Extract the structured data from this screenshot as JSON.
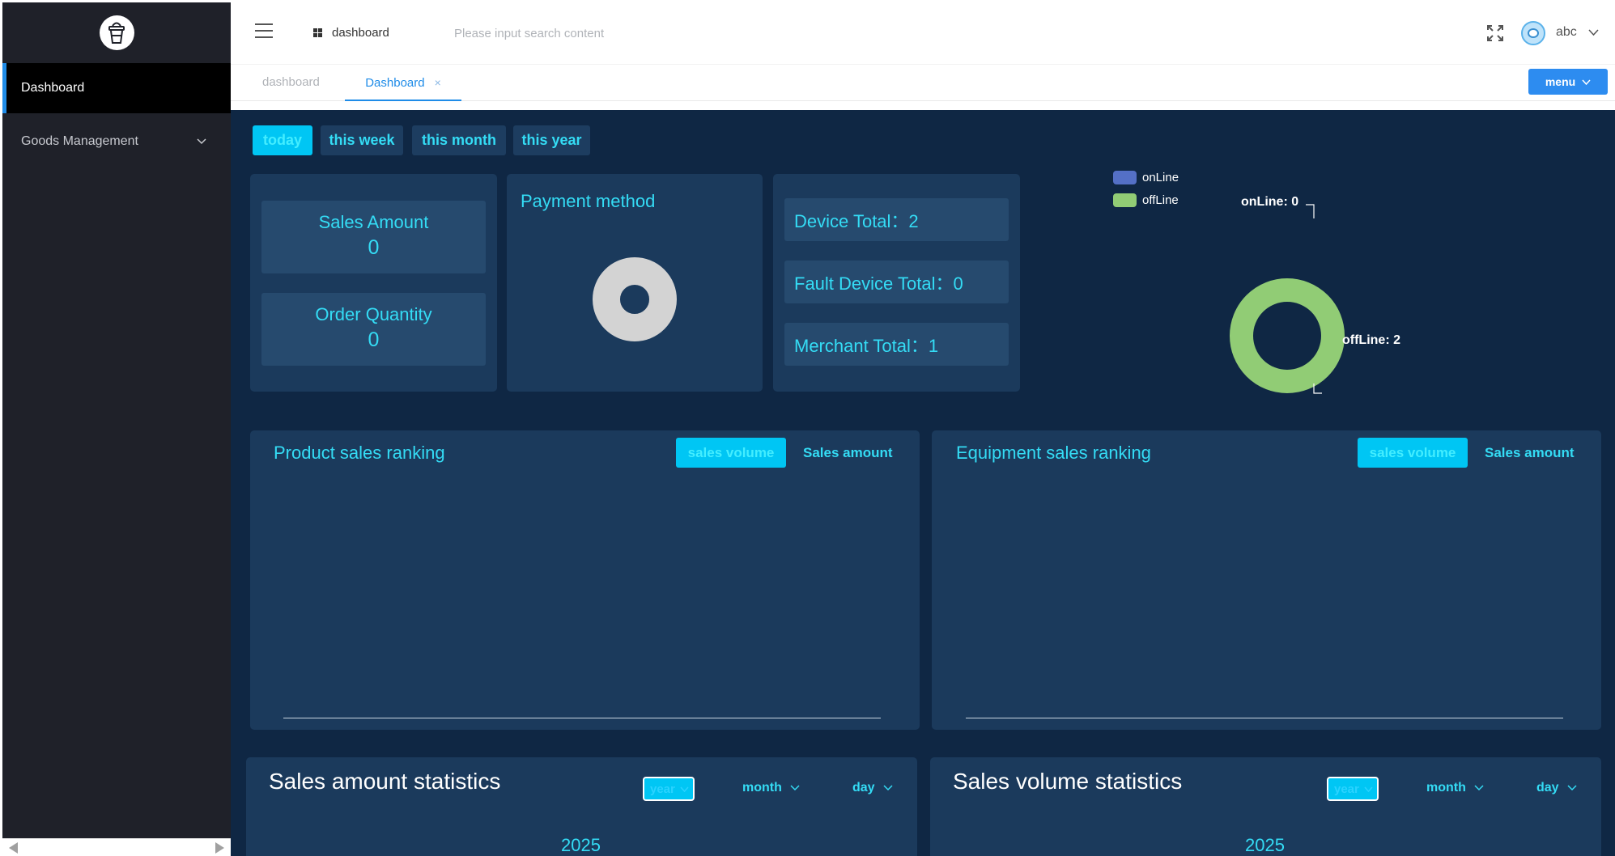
{
  "sidebar": {
    "logo_icon": "drink-cup-icon",
    "items": [
      {
        "label": "Dashboard",
        "active": true
      },
      {
        "label": "Goods Management",
        "active": false
      }
    ]
  },
  "header": {
    "breadcrumb": "dashboard",
    "search_placeholder": "Please input search content",
    "user_name": "abc"
  },
  "tabs": {
    "items": [
      "dashboard",
      "Dashboard"
    ],
    "close_symbol": "×",
    "menu_label": "menu"
  },
  "periods": [
    "today",
    "this week",
    "this month",
    "this year"
  ],
  "stats": {
    "sales_amount_label": "Sales Amount",
    "sales_amount_value": "0",
    "order_quantity_label": "Order Quantity",
    "order_quantity_value": "0"
  },
  "payment": {
    "title": "Payment method"
  },
  "devices": {
    "device_total": "Device Total：2",
    "fault_device_total": "Fault Device Total：0",
    "merchant_total": "Merchant Total：1"
  },
  "chart_data": {
    "type": "pie",
    "legend": [
      "onLine",
      "offLine"
    ],
    "labels": [
      "onLine",
      "offLine"
    ],
    "values": [
      0,
      2
    ],
    "colors": [
      "#5470c6",
      "#91cc75"
    ],
    "data_labels": [
      "onLine: 0",
      "offLine: 2"
    ],
    "legend_placement": "top-left"
  },
  "rankings": {
    "product_title": "Product sales ranking",
    "equipment_title": "Equipment sales ranking",
    "sales_volume": "sales volume",
    "sales_amount": "Sales amount"
  },
  "statistics": {
    "amount_title": "Sales amount statistics",
    "volume_title": "Sales volume statistics",
    "year": "year",
    "month": "month",
    "day": "day",
    "current_year": "2025"
  },
  "colors": {
    "sidebar_bg": "#1f2129",
    "main_bg": "#0f2744",
    "panel_bg": "#1b3a5c",
    "accent_cyan": "#34dcf5",
    "primary_blue": "#2d8cf0"
  }
}
